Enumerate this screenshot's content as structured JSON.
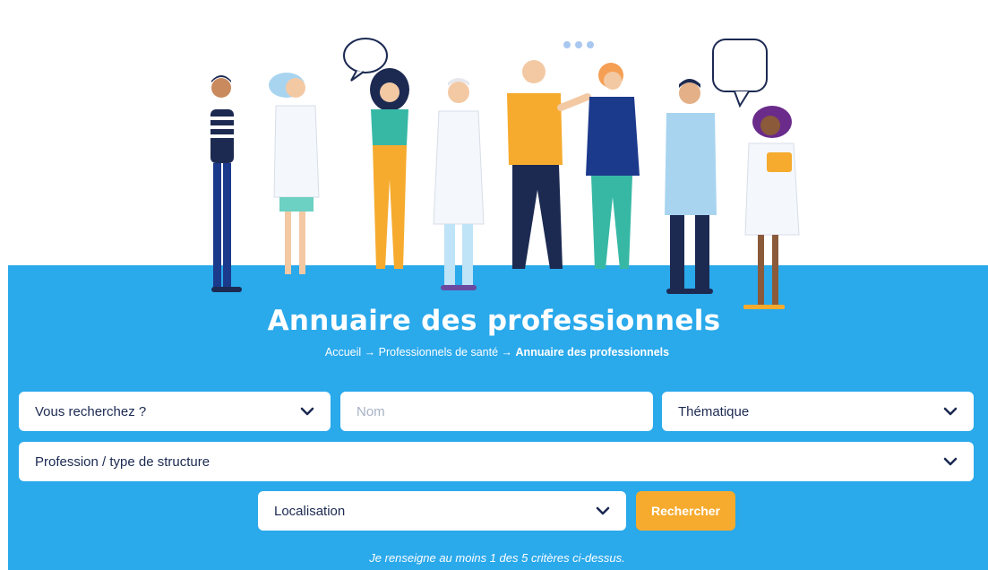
{
  "header": {
    "title": "Annuaire des professionnels",
    "breadcrumb": {
      "home": "Accueil",
      "section": "Professionnels de santé",
      "current": "Annuaire des professionnels",
      "separator": "→"
    }
  },
  "search": {
    "looking_for": {
      "label": "Vous recherchez ?",
      "icon": "chevron-down-icon"
    },
    "name": {
      "placeholder": "Nom"
    },
    "theme": {
      "label": "Thématique",
      "icon": "chevron-down-icon"
    },
    "profession": {
      "label": "Profession / type de structure",
      "icon": "chevron-down-icon"
    },
    "location": {
      "label": "Localisation",
      "icon": "chevron-down-icon"
    },
    "submit_label": "Rechercher",
    "hint": "Je renseigne au moins 1 des 5 critères ci-dessus."
  },
  "colors": {
    "band": "#2aa9eb",
    "button": "#f6ab2e",
    "text_dark": "#1c2a52"
  }
}
